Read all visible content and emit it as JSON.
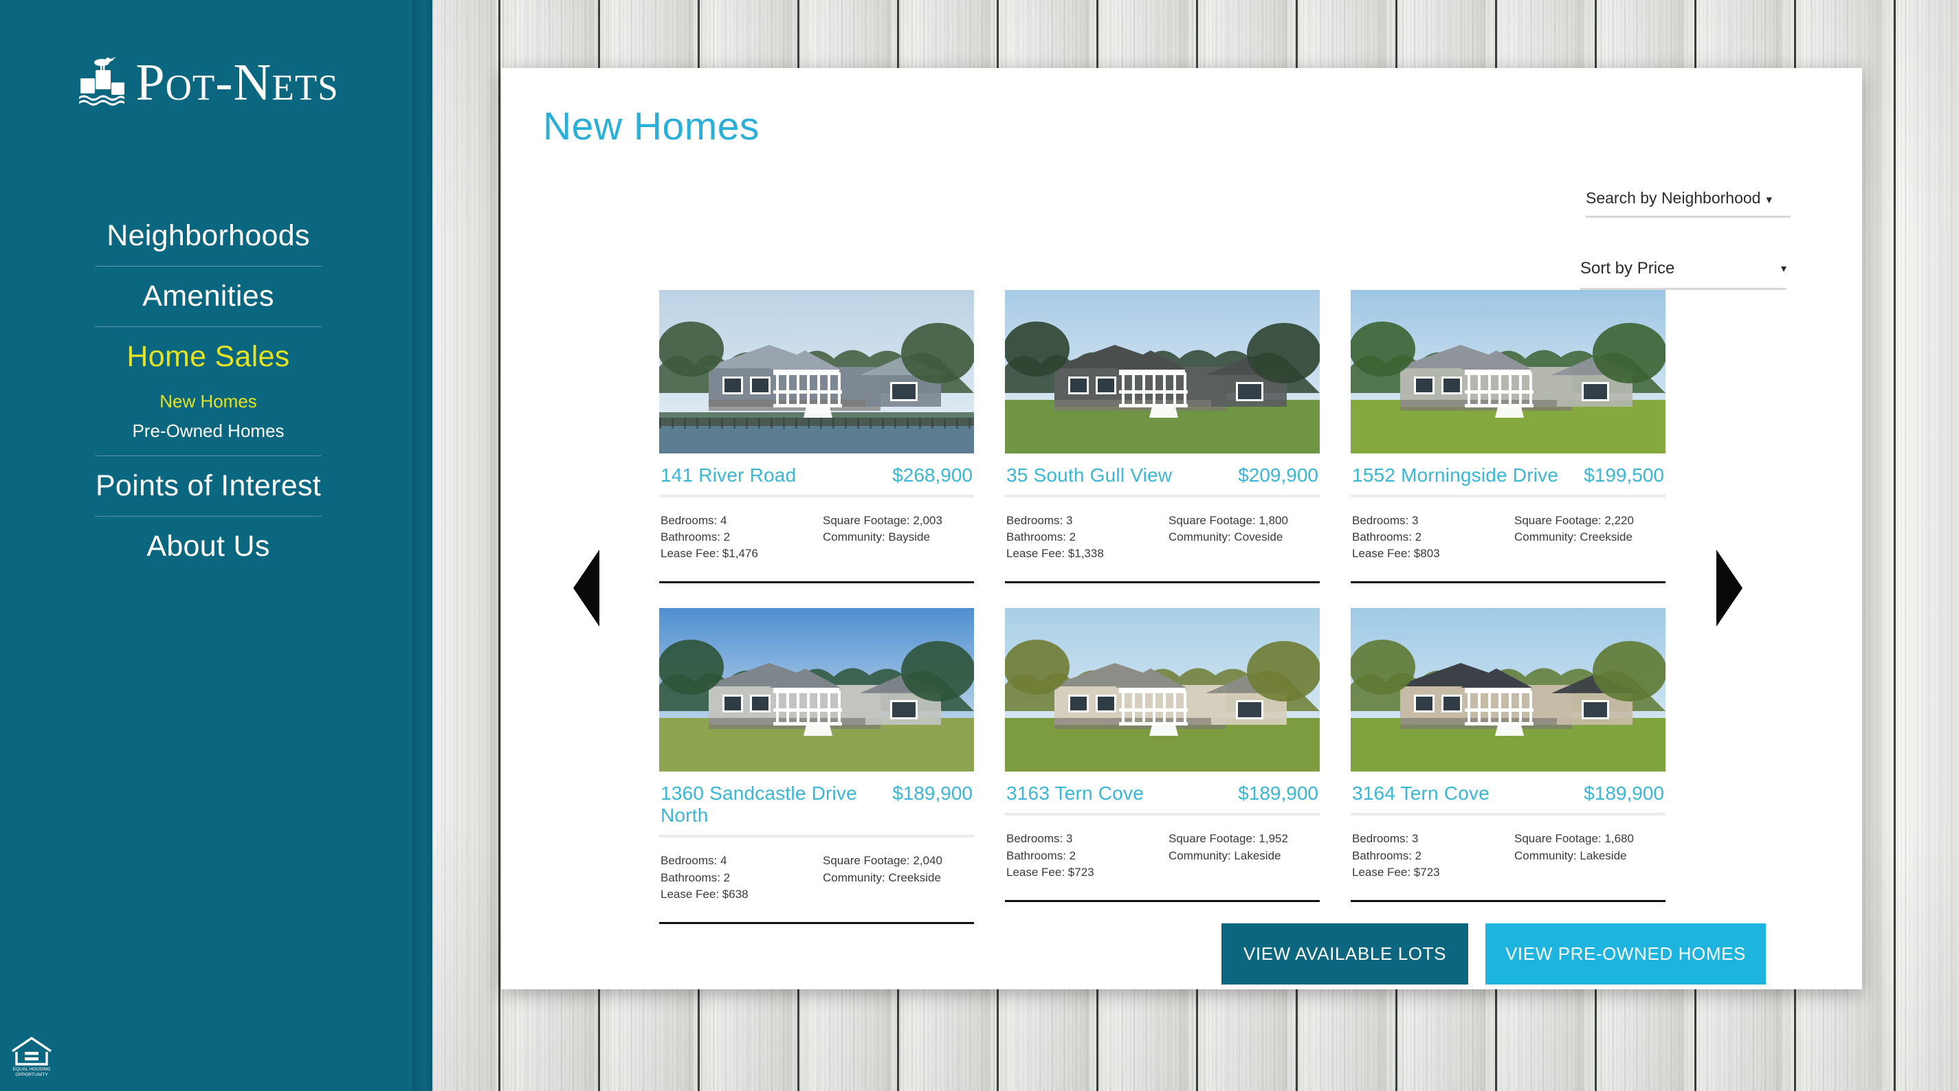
{
  "brand": {
    "name": "Pot-Nets",
    "logo_icon": "seagull-on-pilings-icon"
  },
  "sidebar": {
    "items": [
      {
        "label": "Neighborhoods",
        "active": false
      },
      {
        "label": "Amenities",
        "active": false
      },
      {
        "label": "Home Sales",
        "active": true
      },
      {
        "label": "Points of Interest",
        "active": false
      },
      {
        "label": "About Us",
        "active": false
      }
    ],
    "subitems": [
      {
        "label": "New Homes",
        "active": true
      },
      {
        "label": "Pre-Owned Homes",
        "active": false
      }
    ],
    "footer_logo": {
      "line1": "EQUAL HOUSING",
      "line2": "OPPORTUNITY",
      "icon": "equal-housing-icon"
    }
  },
  "main": {
    "title": "New Homes",
    "search_dropdown": {
      "label": "Search by Neighborhood",
      "caret": "▾"
    },
    "sort_dropdown": {
      "label": "Sort by Price",
      "caret": "▾"
    },
    "prev_arrow_icon": "chevron-left-icon",
    "next_arrow_icon": "chevron-right-icon",
    "labels": {
      "bedrooms": "Bedrooms:",
      "bathrooms": "Bathrooms:",
      "lease_fee": "Lease Fee:",
      "square_footage": "Square Footage:",
      "community": "Community:"
    },
    "listings": [
      {
        "address": "141 River Road",
        "price": "$268,900",
        "bedrooms": "4",
        "bathrooms": "2",
        "lease_fee": "$1,476",
        "square_footage": "2,003",
        "community": "Bayside",
        "photo": "waterfront-gray-home-photo"
      },
      {
        "address": "35 South Gull View",
        "price": "$209,900",
        "bedrooms": "3",
        "bathrooms": "2",
        "lease_fee": "$1,338",
        "square_footage": "1,800",
        "community": "Coveside",
        "photo": "dark-gray-porch-home-photo"
      },
      {
        "address": "1552 Morningside Drive",
        "price": "$199,500",
        "bedrooms": "3",
        "bathrooms": "2",
        "lease_fee": "$803",
        "square_footage": "2,220",
        "community": "Creekside",
        "photo": "shaded-lawn-home-photo"
      },
      {
        "address": "1360 Sandcastle Drive North",
        "price": "$189,900",
        "bedrooms": "4",
        "bathrooms": "2",
        "lease_fee": "$638",
        "square_footage": "2,040",
        "community": "Creekside",
        "photo": "gray-ranch-home-photo"
      },
      {
        "address": "3163 Tern Cove",
        "price": "$189,900",
        "bedrooms": "3",
        "bathrooms": "2",
        "lease_fee": "$723",
        "square_footage": "1,952",
        "community": "Lakeside",
        "photo": "beige-garage-home-photo"
      },
      {
        "address": "3164 Tern Cove",
        "price": "$189,900",
        "bedrooms": "3",
        "bathrooms": "2",
        "lease_fee": "$723",
        "square_footage": "1,680",
        "community": "Lakeside",
        "photo": "tan-gable-home-photo"
      }
    ],
    "buttons": {
      "view_lots": "VIEW AVAILABLE LOTS",
      "view_preowned": "VIEW PRE-OWNED HOMES"
    }
  },
  "colors": {
    "sidebar_teal": "#0b667f",
    "accent_cyan": "#2ab0d8",
    "active_yellow": "#e4e223",
    "button_dark": "#0b667f",
    "button_light": "#1db4e0"
  }
}
